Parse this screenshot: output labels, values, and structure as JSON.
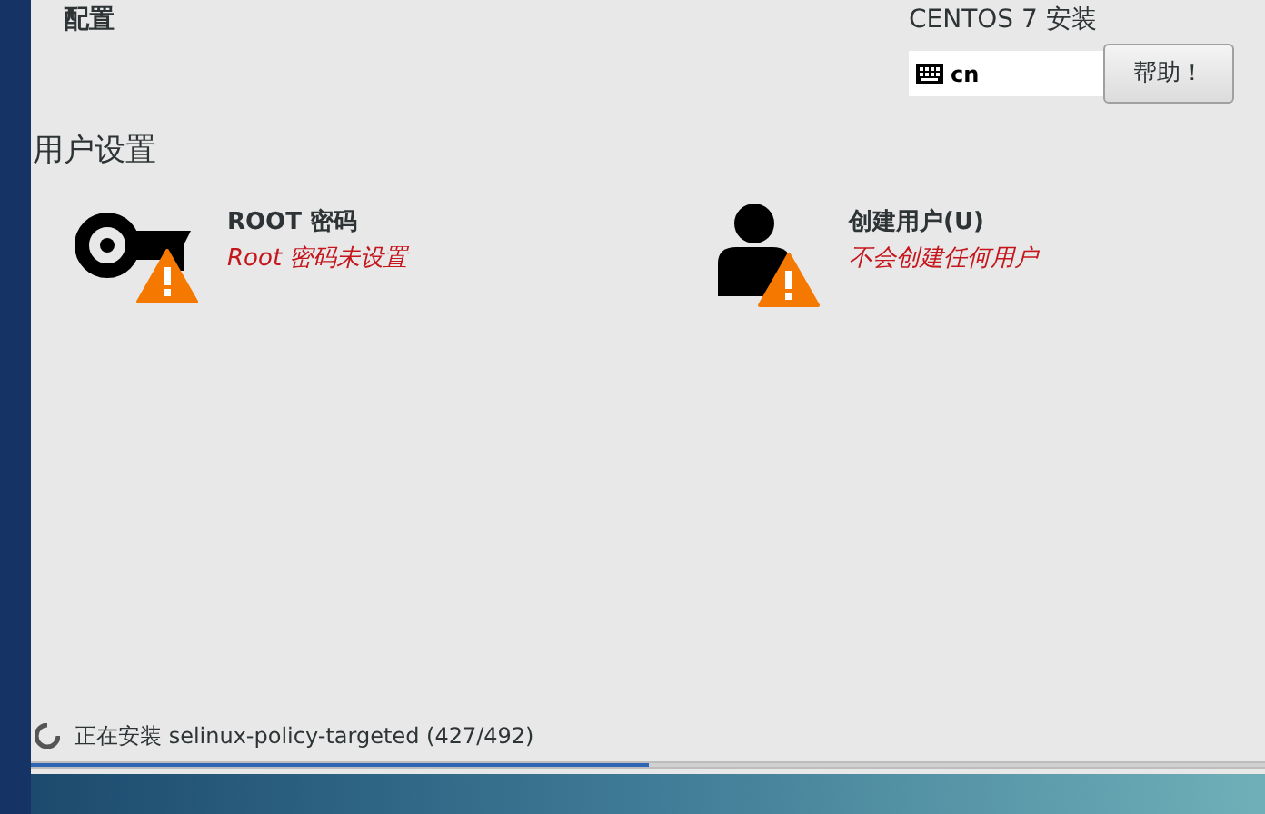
{
  "header": {
    "title": "配置",
    "product": "CENTOS 7 安装",
    "keyboard_layout": "cn",
    "help_button": "帮助！"
  },
  "section": {
    "title": "用户设置",
    "spokes": [
      {
        "kind": "key",
        "title": "ROOT 密码",
        "status": "Root 密码未设置",
        "warning": true
      },
      {
        "kind": "user",
        "title": "创建用户(U)",
        "status": "不会创建任何用户",
        "warning": true
      }
    ]
  },
  "progress": {
    "message": "正在安装 selinux-policy-targeted (427/492)",
    "level": 0.5
  }
}
